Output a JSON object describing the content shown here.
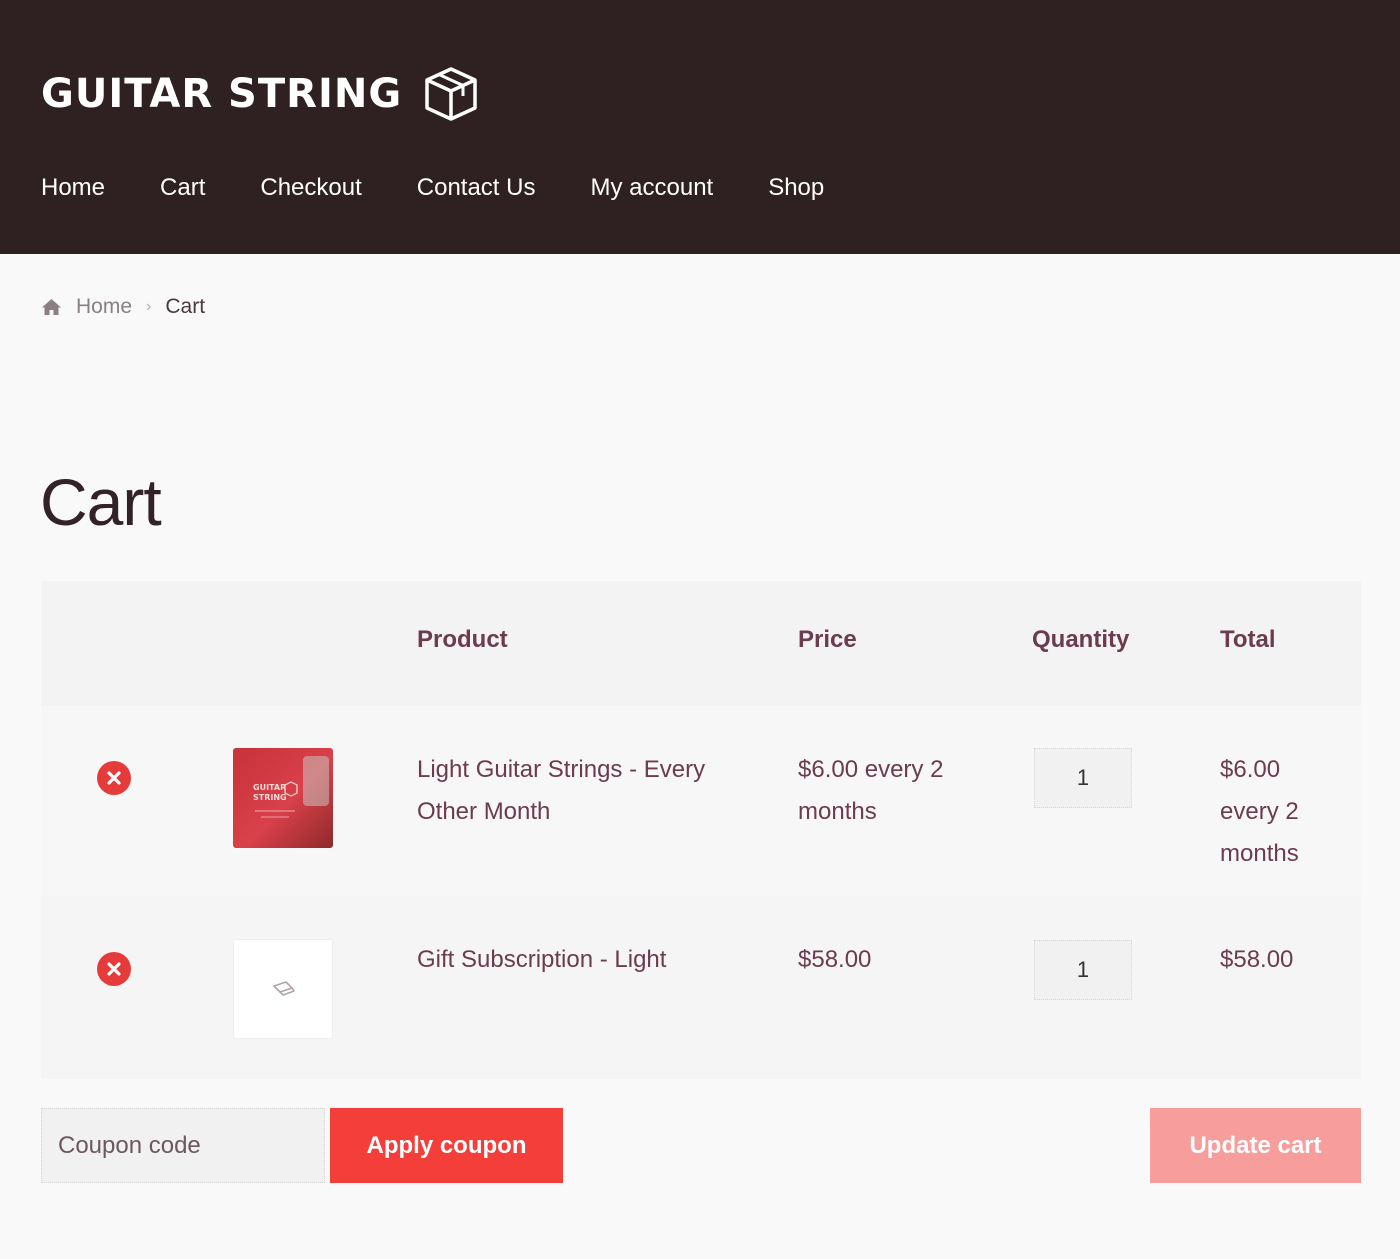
{
  "header": {
    "logo_text": "GUITAR STRING",
    "background_color": "#2f2122",
    "nav": [
      {
        "label": "Home"
      },
      {
        "label": "Cart"
      },
      {
        "label": "Checkout"
      },
      {
        "label": "Contact Us"
      },
      {
        "label": "My account"
      },
      {
        "label": "Shop"
      }
    ]
  },
  "breadcrumb": {
    "icon": "home-icon",
    "home": "Home",
    "current": "Cart"
  },
  "page": {
    "title": "Cart"
  },
  "cart": {
    "columns": {
      "product": "Product",
      "price": "Price",
      "quantity": "Quantity",
      "total": "Total"
    },
    "items": [
      {
        "product_line1": "Light Guitar Strings - Every",
        "product_line2": "Other Month",
        "price_line1": "$6.00 every 2",
        "price_line2": "months",
        "quantity": "1",
        "total_line1": "$6.00",
        "total_line2": "every 2",
        "total_line3": "months",
        "thumbnail_text": "GUITAR STRING"
      },
      {
        "product_line1": "Gift Subscription - Light",
        "price_line1": "$58.00",
        "quantity": "1",
        "total_line1": "$58.00"
      }
    ]
  },
  "actions": {
    "coupon_placeholder": "Coupon code",
    "apply_label": "Apply coupon",
    "update_label": "Update cart"
  },
  "colors": {
    "accent": "#f43e3a",
    "accent_disabled": "#f79e9c",
    "text": "#6b3b4f"
  }
}
